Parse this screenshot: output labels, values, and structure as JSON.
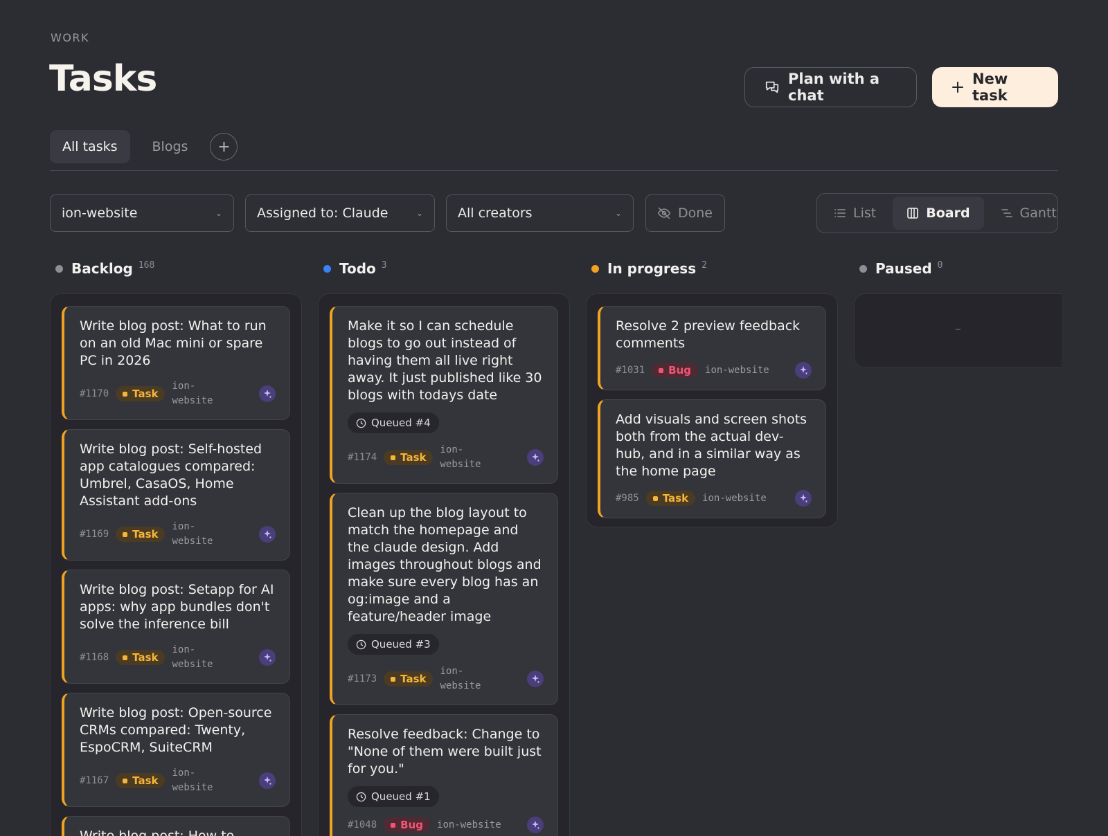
{
  "header": {
    "eyebrow": "WORK",
    "title": "Tasks",
    "plan_label": "Plan with a chat",
    "new_label": "New task"
  },
  "tabs": [
    {
      "label": "All tasks",
      "active": true
    },
    {
      "label": "Blogs",
      "active": false
    }
  ],
  "filters": {
    "project": "ion-website",
    "assigned": "Assigned to: Claude",
    "creators": "All creators",
    "done": "Done"
  },
  "views": {
    "list": "List",
    "board": "Board",
    "gantt": "Gantt",
    "active": "board"
  },
  "colors": {
    "backlog": "#8e8e94",
    "todo": "#3b82f6",
    "in_progress": "#f0a323",
    "paused": "#8e8e94",
    "task": "#f5b53a",
    "bug": "#f25576",
    "accent": "#fdeedd"
  },
  "columns": {
    "backlog": {
      "name": "Backlog",
      "count": "168",
      "cards": [
        {
          "title": "Write blog post: What to run on an old Mac mini or spare PC in 2026",
          "id": "#1170",
          "type": "Task",
          "project": "ion-website"
        },
        {
          "title": "Write blog post: Self-hosted app catalogues compared: Umbrel, CasaOS, Home Assistant add-ons",
          "id": "#1169",
          "type": "Task",
          "project": "ion-website"
        },
        {
          "title": "Write blog post: Setapp for AI apps: why app bundles don't solve the inference bill",
          "id": "#1168",
          "type": "Task",
          "project": "ion-website"
        },
        {
          "title": "Write blog post: Open-source CRMs compared: Twenty, EspoCRM, SuiteCRM",
          "id": "#1167",
          "type": "Task",
          "project": "ion-website"
        },
        {
          "title": "Write blog post: How to",
          "id": "",
          "type": "",
          "project": ""
        }
      ]
    },
    "todo": {
      "name": "Todo",
      "count": "3",
      "cards": [
        {
          "title": "Make it so I can schedule blogs to go out instead of having them all live right away. It just published like 30 blogs with todays date",
          "queued": "Queued #4",
          "id": "#1174",
          "type": "Task",
          "project": "ion-website"
        },
        {
          "title": "Clean up the blog layout to match the homepage and the claude design. Add images throughout blogs and make sure every blog has an og:image and a feature/header image",
          "queued": "Queued #3",
          "id": "#1173",
          "type": "Task",
          "project": "ion-website"
        },
        {
          "title": "Resolve feedback: Change to \"None of them were built just for you.\"",
          "queued": "Queued #1",
          "id": "#1048",
          "type": "Bug",
          "project": "ion-website"
        }
      ]
    },
    "in_progress": {
      "name": "In progress",
      "count": "2",
      "cards": [
        {
          "title": "Resolve 2 preview feedback comments",
          "id": "#1031",
          "type": "Bug",
          "project": "ion-website"
        },
        {
          "title": "Add visuals and screen shots both from the actual dev-hub, and in a similar way as the home page",
          "id": "#985",
          "type": "Task",
          "project": "ion-website"
        }
      ]
    },
    "paused": {
      "name": "Paused",
      "count": "0",
      "empty": "–"
    }
  }
}
